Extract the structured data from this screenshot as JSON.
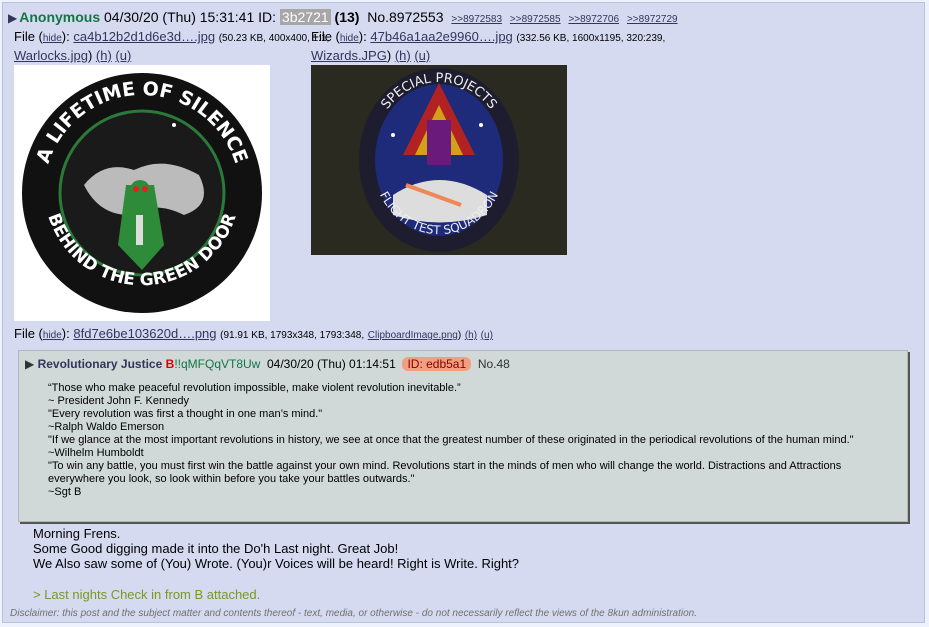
{
  "post": {
    "name": "Anonymous",
    "datetime": "04/30/20 (Thu) 15:31:41",
    "id_label": "ID:",
    "id_value": "3b2721",
    "count": "(13)",
    "number": "No.8972553",
    "replies": [
      ">>8972583",
      ">>8972585",
      ">>8972706",
      ">>8972729"
    ]
  },
  "files": [
    {
      "prefix": "File (",
      "hide": "hide",
      "sep": "):",
      "filename": "ca4b12b2d1d6e3d….jpg",
      "meta_open": "(50.23 KB, 400x400, 1:1,",
      "original": "Warlocks.jpg",
      "meta_close": ")",
      "h": "(h)",
      "u": "(u)"
    },
    {
      "prefix": "File (",
      "hide": "hide",
      "sep": "):",
      "filename": "47b46a1aa2e9960….jpg",
      "meta_open": "(332.56 KB, 1600x1195, 320:239,",
      "original": "Wizards.JPG",
      "meta_close": ")",
      "h": "(h)",
      "u": "(u)"
    },
    {
      "prefix": "File (",
      "hide": "hide",
      "sep": "):",
      "filename": "8fd7e6be103620d….png",
      "meta_open": "(91.91 KB, 1793x348, 1793:348,",
      "original": "ClipboardImage.png",
      "meta_close": ")",
      "h": "(h)",
      "u": "(u)"
    }
  ],
  "images": {
    "patch1": {
      "top_text": "A LIFETIME OF SILENCE",
      "bottom_text": "BEHIND THE GREEN DOOR"
    },
    "patch2": {
      "top_text": "SPECIAL PROJECTS",
      "bottom_text": "FLIGHT TEST SQUADRON"
    }
  },
  "quoted": {
    "name": "Revolutionary Justice",
    "cap": "B",
    "trip": "!!qMFQqVT8Uw",
    "datetime": "04/30/20 (Thu) 01:14:51",
    "id": "ID: edb5a1",
    "number": "No.48",
    "lines": [
      "“Those who make peaceful revolution impossible, make violent revolution inevitable.”",
      "~ President John F. Kennedy",
      "\"Every revolution was first a thought in one man’s mind.\"",
      "~Ralph Waldo Emerson",
      "\"If we glance at the most important revolutions in history, we see at once that the greatest number of these originated in the periodical revolutions of the human mind.\"",
      "~Wilhelm Humboldt",
      "\"To win any battle, you must first win the battle against your own mind. Revolutions start in the minds of men who will change the world. Distractions and Attractions everywhere you look, so look within before you take your battles outwards.\"",
      "~Sgt B"
    ]
  },
  "body": {
    "lines": [
      "Morning Frens.",
      "Some Good digging made it into the Do'h Last night. Great Job!",
      "We Also saw some of (You) Wrote. (You)r Voices will be heard! Right is Write. Right?"
    ],
    "greentext": "> Last nights Check in from B attached."
  },
  "disclaimer": "Disclaimer: this post and the subject matter and contents thereof - text, media, or otherwise - do not necessarily reflect the views of the 8kun administration.",
  "colors": {
    "name_green": "#117743",
    "link": "#34345c",
    "greentext": "#789922",
    "post_bg": "#d6daf0"
  }
}
